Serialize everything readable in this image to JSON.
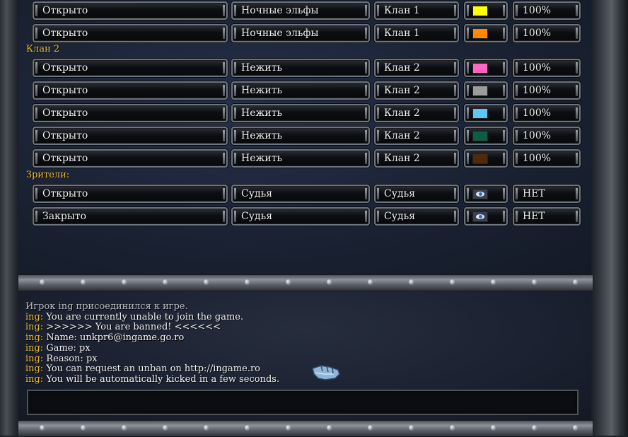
{
  "lobby": {
    "sections": [
      {
        "label": ""
      },
      {
        "label": "Клан 2"
      },
      {
        "label": "Зрители:"
      }
    ],
    "rows": [
      {
        "status": "Открыто",
        "race": "Ночные эльфы",
        "team": "Клан 1",
        "color": "#ffff00",
        "kind": "color",
        "handicap": "100%"
      },
      {
        "status": "Открыто",
        "race": "Ночные эльфы",
        "team": "Клан 1",
        "color": "#ff8800",
        "kind": "color",
        "handicap": "100%"
      },
      {
        "status": "Открыто",
        "race": "Нежить",
        "team": "Клан 2",
        "color": "#ff66c4",
        "kind": "color",
        "handicap": "100%"
      },
      {
        "status": "Открыто",
        "race": "Нежить",
        "team": "Клан 2",
        "color": "#9b9b9b",
        "kind": "color",
        "handicap": "100%"
      },
      {
        "status": "Открыто",
        "race": "Нежить",
        "team": "Клан 2",
        "color": "#5ec6f5",
        "kind": "color",
        "handicap": "100%"
      },
      {
        "status": "Открыто",
        "race": "Нежить",
        "team": "Клан 2",
        "color": "#0d5c44",
        "kind": "color",
        "handicap": "100%"
      },
      {
        "status": "Открыто",
        "race": "Нежить",
        "team": "Клан 2",
        "color": "#4f2a0e",
        "kind": "color",
        "handicap": "100%"
      },
      {
        "status": "Открыто",
        "race": "Судья",
        "team": "Судья",
        "color": "",
        "kind": "eye-icon",
        "handicap": "НЕТ"
      },
      {
        "status": "Закрыто",
        "race": "Судья",
        "team": "Судья",
        "color": "",
        "kind": "eye-icon",
        "handicap": "НЕТ"
      }
    ]
  },
  "chat": {
    "lines": [
      {
        "who": "",
        "text": "Игрок ing присоединился к игре."
      },
      {
        "who": "ing:",
        "text": " You are currently unable to join the game."
      },
      {
        "who": "ing:",
        "text": " >>>>>> You are banned! <<<<<<"
      },
      {
        "who": "ing:",
        "text": " Name: unkpr6@ingame.go.ro"
      },
      {
        "who": "ing:",
        "text": " Game: px"
      },
      {
        "who": "ing:",
        "text": " Reason: px"
      },
      {
        "who": "ing:",
        "text": " You can request an unban on http://ingame.ro"
      },
      {
        "who": "ing:",
        "text": " You will be automatically kicked in a few seconds."
      }
    ],
    "input_value": ""
  },
  "colors": {
    "accent": "#f2c12e",
    "text": "#f1f1f1"
  }
}
